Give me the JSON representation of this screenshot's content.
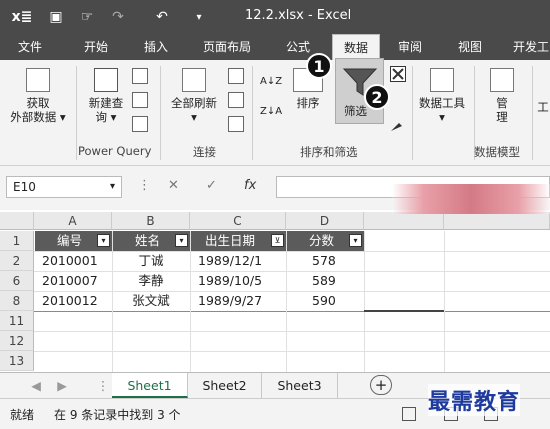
{
  "quick_access": {
    "app_icon": "X≡",
    "save_icon": "save-icon",
    "touch_icon": "touch-mode-icon",
    "redo_icon": "redo-icon",
    "undo_icon": "undo-icon",
    "customize_icon": "customize-qat-icon",
    "app_glyph": "x≣",
    "save_glyph": "▣",
    "touch_glyph": "☞",
    "redo_glyph": "↷",
    "undo_glyph": "↶",
    "more_glyph": "▾"
  },
  "window": {
    "title": "12.2.xlsx - Excel"
  },
  "tabs": [
    {
      "label": "文件"
    },
    {
      "label": "开始"
    },
    {
      "label": "插入"
    },
    {
      "label": "页面布局"
    },
    {
      "label": "公式"
    },
    {
      "label": "数据"
    },
    {
      "label": "审阅"
    },
    {
      "label": "视图"
    },
    {
      "label": "开发工"
    }
  ],
  "ribbon": {
    "get_external_data": {
      "line1": "获取",
      "line2": "外部数据 ▾"
    },
    "new_query": {
      "line1": "新建查",
      "line2": "询 ▾"
    },
    "power_query_label": "Power Query",
    "refresh_all": {
      "label": "全部刷新",
      "arrow": "▾"
    },
    "connections_label": "连接",
    "sort_az": "A↓Z",
    "sort_za": "Z↓A",
    "sort_button": {
      "label": "排序"
    },
    "filter_button": {
      "label": "筛选"
    },
    "sort_filter_label": "排序和筛选",
    "data_tools": {
      "label": "数据工具",
      "arrow": "▾"
    },
    "manage": {
      "line1": "管",
      "line2": "理"
    },
    "data_model_label": "数据模型",
    "partial_label": "工"
  },
  "callouts": [
    "1",
    "2"
  ],
  "formula_bar": {
    "name_box": "E10",
    "name_dropdown": "▾",
    "more": "⋮",
    "cancel_glyph": "✕",
    "enter_glyph": "✓",
    "fx_glyph": "fx",
    "value": ""
  },
  "sheet": {
    "columns": [
      "A",
      "B",
      "C",
      "D"
    ],
    "header_row": [
      "编号",
      "姓名",
      "出生日期",
      "分数"
    ],
    "visible_rows": [
      {
        "row": "1",
        "cells": [
          "编号",
          "姓名",
          "出生日期",
          "分数"
        ]
      },
      {
        "row": "2",
        "cells": [
          "2010001",
          "丁诚",
          "1989/12/1",
          "578"
        ]
      },
      {
        "row": "6",
        "cells": [
          "2010007",
          "李静",
          "1989/10/5",
          "589"
        ]
      },
      {
        "row": "8",
        "cells": [
          "2010012",
          "张文斌",
          "1989/9/27",
          "590"
        ]
      },
      {
        "row": "11",
        "cells": [
          "",
          "",
          "",
          ""
        ]
      },
      {
        "row": "12",
        "cells": [
          "",
          "",
          "",
          ""
        ]
      },
      {
        "row": "13",
        "cells": [
          "",
          "",
          "",
          ""
        ]
      }
    ],
    "filter_glyph": "▾",
    "filtered_glyph": "⊻"
  },
  "sheet_tabs": {
    "nav_prev": "◀",
    "nav_next": "▶",
    "tabs": [
      {
        "label": "Sheet1",
        "active": true
      },
      {
        "label": "Sheet2",
        "active": false
      },
      {
        "label": "Sheet3",
        "active": false
      }
    ],
    "add_glyph": "+",
    "more": "⋮"
  },
  "status": {
    "ready": "就绪",
    "filter_result": "在 9 条记录中找到 3 个"
  },
  "watermark": "最需教育",
  "colors": {
    "titlebar": "#4a4a4a",
    "header_fill": "#5b5b5b",
    "accent_green": "#1e7145"
  }
}
